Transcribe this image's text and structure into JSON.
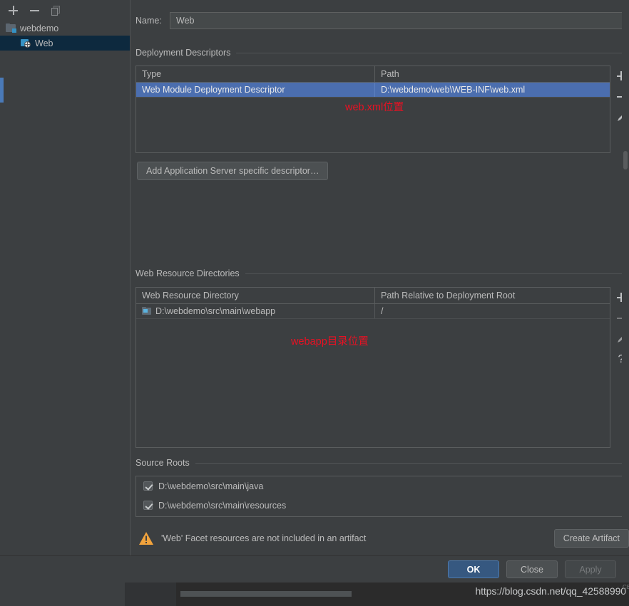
{
  "window": {
    "background_color": "#3c3f41",
    "accent_color": "#4b6eaf",
    "selection_color": "#0d293e"
  },
  "tree_toolbar": {
    "add_label": "+",
    "remove_label": "−",
    "copy_label": "Copy"
  },
  "tree": {
    "items": [
      {
        "label": "webdemo",
        "level": 1,
        "icon": "module-folder-icon",
        "selected": false
      },
      {
        "label": "Web",
        "level": 2,
        "icon": "web-facet-icon",
        "selected": true
      }
    ]
  },
  "name_field": {
    "label": "Name:",
    "value": "Web",
    "placeholder": ""
  },
  "deployment_descriptors": {
    "section_title": "Deployment Descriptors",
    "columns": [
      "Type",
      "Path"
    ],
    "rows": [
      {
        "type": "Web Module Deployment Descriptor",
        "path": "D:\\webdemo\\web\\WEB-INF\\web.xml",
        "selected": true
      }
    ],
    "tools": [
      "add-icon",
      "remove-icon",
      "edit-pencil-icon"
    ],
    "add_descriptor_button": "Add Application Server specific descriptor…"
  },
  "web_resource_directories": {
    "section_title": "Web Resource Directories",
    "columns": [
      "Web Resource Directory",
      "Path Relative to Deployment Root"
    ],
    "rows": [
      {
        "directory": "D:\\webdemo\\src\\main\\webapp",
        "relative_path": "/",
        "selected": false
      }
    ],
    "tools": [
      "add-icon",
      "remove-icon",
      "edit-pencil-icon",
      "help-icon"
    ]
  },
  "source_roots": {
    "section_title": "Source Roots",
    "items": [
      {
        "label": "D:\\webdemo\\src\\main\\java",
        "checked": true
      },
      {
        "label": "D:\\webdemo\\src\\main\\resources",
        "checked": true
      }
    ]
  },
  "warning": {
    "icon": "warning-triangle-icon",
    "message": "'Web' Facet resources are not included in an artifact",
    "action_label": "Create Artifact",
    "icon_color": "#f2a33c"
  },
  "dialog_buttons": {
    "ok": "OK",
    "close": "Close",
    "apply": "Apply",
    "apply_disabled": true
  },
  "annotations": [
    {
      "text": "web.xml位置",
      "color": "#e81123"
    },
    {
      "text": "webapp目录位置",
      "color": "#e81123"
    }
  ],
  "watermark": {
    "url": "https://blog.csdn.net/qq_42588990",
    "side_text": "CBo"
  }
}
